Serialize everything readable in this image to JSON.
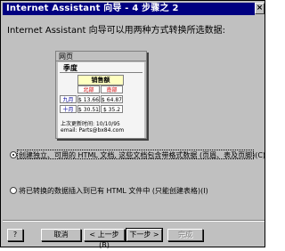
{
  "window": {
    "title": "Internet Assistant 向导 - 4 步骤之 2",
    "close_label": "×"
  },
  "prompt": "Internet Assistant 向导可以用两种方式转换所选数据:",
  "preview": {
    "window_title": "网页",
    "heading": "季度",
    "banner": "销售额",
    "table": {
      "header": [
        "北部",
        "南部"
      ],
      "rows": [
        {
          "label": "九月",
          "values": [
            "$ 13.66",
            "$ 64.87"
          ]
        },
        {
          "label": "十月",
          "values": [
            "$ 30.51",
            "$ 35.2"
          ]
        }
      ]
    },
    "footer_updated": "上次更新时间: 10/10/95",
    "footer_email": "email: Parts@bx84.com"
  },
  "options": [
    {
      "label": "创建独立、可用的 HTML 文档, 这些文档包含带格式数据 (页眉、表及页脚)(C)",
      "selected": true
    },
    {
      "label": "将已转换的数据插入到已有 HTML 文件中 (只能创建表格)(I)",
      "selected": false
    }
  ],
  "buttons": {
    "help": "?",
    "cancel": "取消",
    "back": "< 上一步(B)",
    "next": "下一步 >",
    "finish": "完成"
  },
  "colors": {
    "titlebar": "#000080",
    "face": "#c0c0c0",
    "red_text": "#cc0000",
    "blue_text": "#000099"
  }
}
